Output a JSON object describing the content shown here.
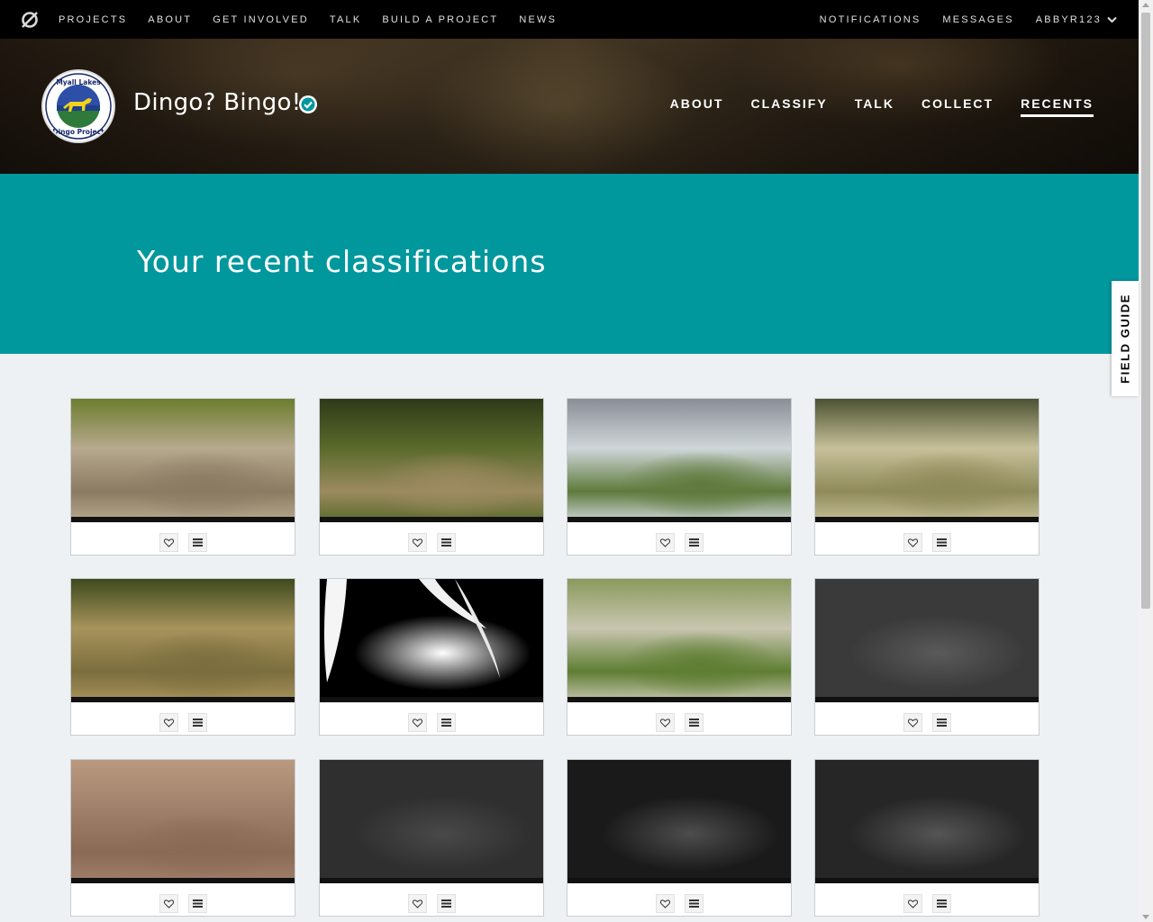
{
  "topbar": {
    "left_nav": [
      "PROJECTS",
      "ABOUT",
      "GET INVOLVED",
      "TALK",
      "BUILD A PROJECT",
      "NEWS"
    ],
    "right_nav": [
      "NOTIFICATIONS",
      "MESSAGES"
    ],
    "username": "ABBYR123",
    "logo_icon": "zooniverse-logo-icon"
  },
  "project": {
    "title": "Dingo? Bingo!",
    "avatar_icon": "myall-lakes-dingo-project-logo",
    "verified_icon": "verified-check-icon",
    "nav": [
      {
        "label": "ABOUT",
        "active": false
      },
      {
        "label": "CLASSIFY",
        "active": false
      },
      {
        "label": "TALK",
        "active": false
      },
      {
        "label": "COLLECT",
        "active": false
      },
      {
        "label": "RECENTS",
        "active": true
      }
    ]
  },
  "hero": {
    "heading": "Your recent classifications"
  },
  "field_guide": {
    "label": "FIELD GUIDE"
  },
  "colors": {
    "teal": "#00979d",
    "topbar": "#000000",
    "background": "#eef1f4"
  },
  "cards": [
    {
      "scene": "day-leaves",
      "colors": [
        "#b7a98e",
        "#8a7b62",
        "#6c7d2e"
      ]
    },
    {
      "scene": "day-track",
      "colors": [
        "#5a6a2c",
        "#9c8a60",
        "#2e3a18"
      ]
    },
    {
      "scene": "day-heath",
      "colors": [
        "#cfd6d9",
        "#5f7a3c",
        "#8a8e96"
      ]
    },
    {
      "scene": "day-foggy-forest",
      "colors": [
        "#c7c09a",
        "#8f8a5a",
        "#4c5232"
      ]
    },
    {
      "scene": "day-sandy-road",
      "colors": [
        "#a8935c",
        "#7b6e3e",
        "#3d4a1e"
      ]
    },
    {
      "scene": "night-ir-leaves",
      "colors": [
        "#000000",
        "#ffffff",
        "#1a1a1a"
      ]
    },
    {
      "scene": "day-dune-scrub",
      "colors": [
        "#c9c6b0",
        "#5f7e33",
        "#8a9a5c"
      ]
    },
    {
      "scene": "night-ir-clearing",
      "colors": [
        "#3a3a3a",
        "#5a5a5a",
        "#1c1c1c"
      ]
    },
    {
      "scene": "day-dirt-leaves",
      "colors": [
        "#a0806a",
        "#8a6a55",
        "#b99a80"
      ]
    },
    {
      "scene": "night-ir-ground",
      "colors": [
        "#2f2f2f",
        "#494949",
        "#222222"
      ]
    },
    {
      "scene": "night-ir-bush",
      "colors": [
        "#1a1a1a",
        "#4d4d4d",
        "#2a2a2a"
      ]
    },
    {
      "scene": "night-ir-dingo",
      "colors": [
        "#262626",
        "#555555",
        "#1a1a1a"
      ]
    }
  ],
  "card_actions": {
    "favorite_icon": "heart-icon",
    "collect_icon": "menu-lines-icon"
  }
}
